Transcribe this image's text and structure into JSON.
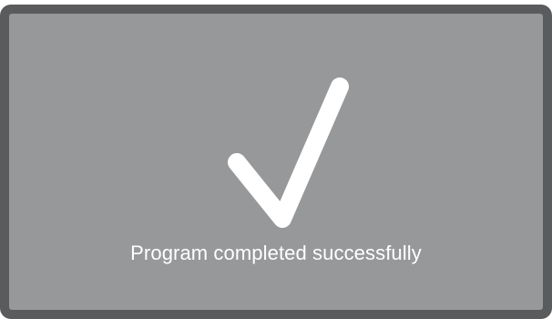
{
  "screen": {
    "icon": "checkmark-icon",
    "message": "Program completed successfully",
    "colors": {
      "bezel": "#5a5b5d",
      "screen": "#97989a",
      "foreground": "#ffffff"
    }
  }
}
